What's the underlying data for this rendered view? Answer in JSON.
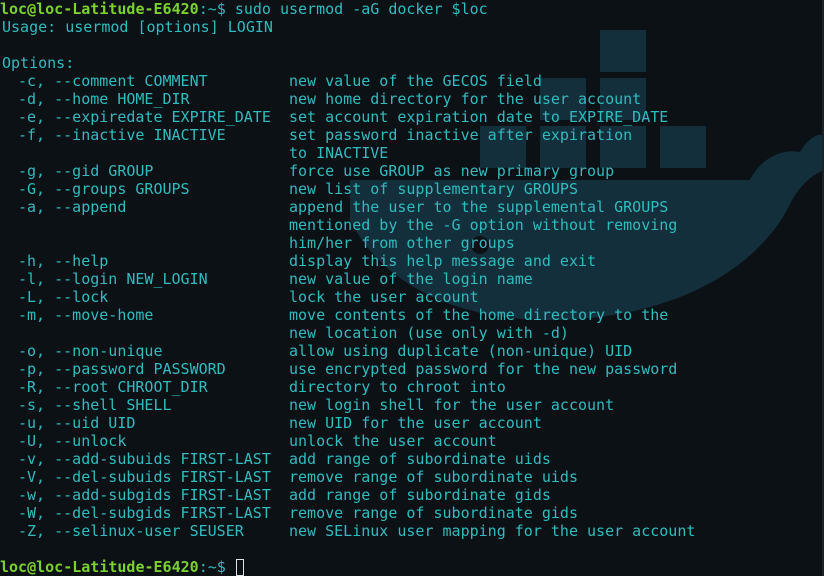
{
  "prompt": {
    "user_host": "loc@loc-Latitude-E6420",
    "separator": ":",
    "path": "~",
    "symbol": "$"
  },
  "command": "sudo usermod -aG docker $loc",
  "usage": "Usage: usermod [options] LOGIN",
  "options_header": "Options:",
  "options": [
    {
      "opt": "-c, --comment COMMENT",
      "desc": "new value of the GECOS field"
    },
    {
      "opt": "-d, --home HOME_DIR",
      "desc": "new home directory for the user account"
    },
    {
      "opt": "-e, --expiredate EXPIRE_DATE",
      "desc": "set account expiration date to EXPIRE_DATE"
    },
    {
      "opt": "-f, --inactive INACTIVE",
      "desc": "set password inactive after expiration"
    },
    {
      "opt": "",
      "desc": "to INACTIVE"
    },
    {
      "opt": "-g, --gid GROUP",
      "desc": "force use GROUP as new primary group"
    },
    {
      "opt": "-G, --groups GROUPS",
      "desc": "new list of supplementary GROUPS"
    },
    {
      "opt": "-a, --append",
      "desc": "append the user to the supplemental GROUPS"
    },
    {
      "opt": "",
      "desc": "mentioned by the -G option without removing"
    },
    {
      "opt": "",
      "desc": "him/her from other groups"
    },
    {
      "opt": "-h, --help",
      "desc": "display this help message and exit"
    },
    {
      "opt": "-l, --login NEW_LOGIN",
      "desc": "new value of the login name"
    },
    {
      "opt": "-L, --lock",
      "desc": "lock the user account"
    },
    {
      "opt": "-m, --move-home",
      "desc": "move contents of the home directory to the"
    },
    {
      "opt": "",
      "desc": "new location (use only with -d)"
    },
    {
      "opt": "-o, --non-unique",
      "desc": "allow using duplicate (non-unique) UID"
    },
    {
      "opt": "-p, --password PASSWORD",
      "desc": "use encrypted password for the new password"
    },
    {
      "opt": "-R, --root CHROOT_DIR",
      "desc": "directory to chroot into"
    },
    {
      "opt": "-s, --shell SHELL",
      "desc": "new login shell for the user account"
    },
    {
      "opt": "-u, --uid UID",
      "desc": "new UID for the user account"
    },
    {
      "opt": "-U, --unlock",
      "desc": "unlock the user account"
    },
    {
      "opt": "-v, --add-subuids FIRST-LAST",
      "desc": "add range of subordinate uids"
    },
    {
      "opt": "-V, --del-subuids FIRST-LAST",
      "desc": "remove range of subordinate uids"
    },
    {
      "opt": "-w, --add-subgids FIRST-LAST",
      "desc": "add range of subordinate gids"
    },
    {
      "opt": "-W, --del-subgids FIRST-LAST",
      "desc": "remove range of subordinate gids"
    },
    {
      "opt": "-Z, --selinux-user SEUSER",
      "desc": "new SELinux user mapping for the user account"
    }
  ],
  "colors": {
    "background": "#0c1116",
    "text": "#2fbcbf",
    "prompt_user": "#7bd12e",
    "wallpaper_whale": "#1f6f8a"
  },
  "wallpaper_icon": "docker-whale-icon"
}
